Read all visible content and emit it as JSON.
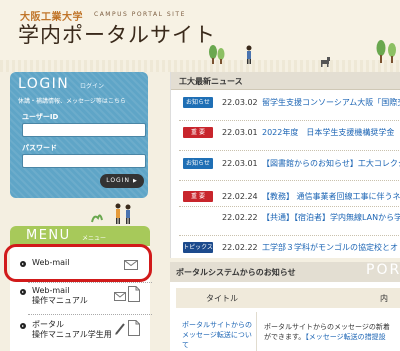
{
  "header": {
    "university": "大阪工業大学",
    "tagline": "CAMPUS PORTAL SITE",
    "title": "学内ポータルサイト"
  },
  "login": {
    "title": "LOGIN",
    "title_jp": "ログイン",
    "note": "休講・補講情報、メッセージ等はこちら",
    "user_label": "ユーザーID",
    "user_value": "",
    "password_label": "パスワード",
    "password_value": "",
    "button_label": "LOGIN"
  },
  "menu": {
    "title": "MENU",
    "title_jp": "メニュー",
    "items": [
      {
        "label": "Web-mail",
        "icon": "mail-icon"
      },
      {
        "label": "Web-mail\n操作マニュアル",
        "icon": "mail-doc-icon"
      },
      {
        "label": "ポータル\n操作マニュアル学生用",
        "icon": "pencil-doc-icon"
      }
    ]
  },
  "news": {
    "title": "工大最新ニュース",
    "rows": [
      {
        "badge": "お知らせ",
        "badge_color": "#1f6fb5",
        "date": "22.03.02",
        "text": "留学生支援コンソーシアム大阪「国際交流員」のお知らせ"
      },
      {
        "badge": "重 要",
        "badge_color": "#c8252c",
        "date": "22.03.01",
        "text": "2022年度　日本学生支援機構奨学金　層について"
      },
      {
        "badge": "お知らせ",
        "badge_color": "#1f6fb5",
        "date": "22.03.01",
        "text": "【図書館からのお知らせ】工大コレクション"
      },
      {
        "badge": "重 要",
        "badge_color": "#c8252c",
        "date": "22.02.24",
        "text": "【教務】 通信事業者回線工事に伴うネ"
      },
      {
        "badge": "",
        "badge_color": "",
        "date": "22.02.22",
        "text": "【共通】【宿泊者】学内無線LANから学外へのい作について"
      },
      {
        "badge": "トピックス",
        "badge_color": "#1c4a8c",
        "date": "22.02.22",
        "text": "工学部３学科がモンゴルの協定校とオ"
      }
    ]
  },
  "portal": {
    "title": "ポータルシステムからのお知らせ",
    "english": "POR",
    "col_title": "タイトル",
    "col_content": "内",
    "row_title": "ポータルサイトからのメッセージ転送について",
    "row_content_a": "ポータルサイトからのメッセージの新着",
    "row_content_b": "ができます。",
    "row_content_link": "【メッセージ転送の措提設"
  }
}
